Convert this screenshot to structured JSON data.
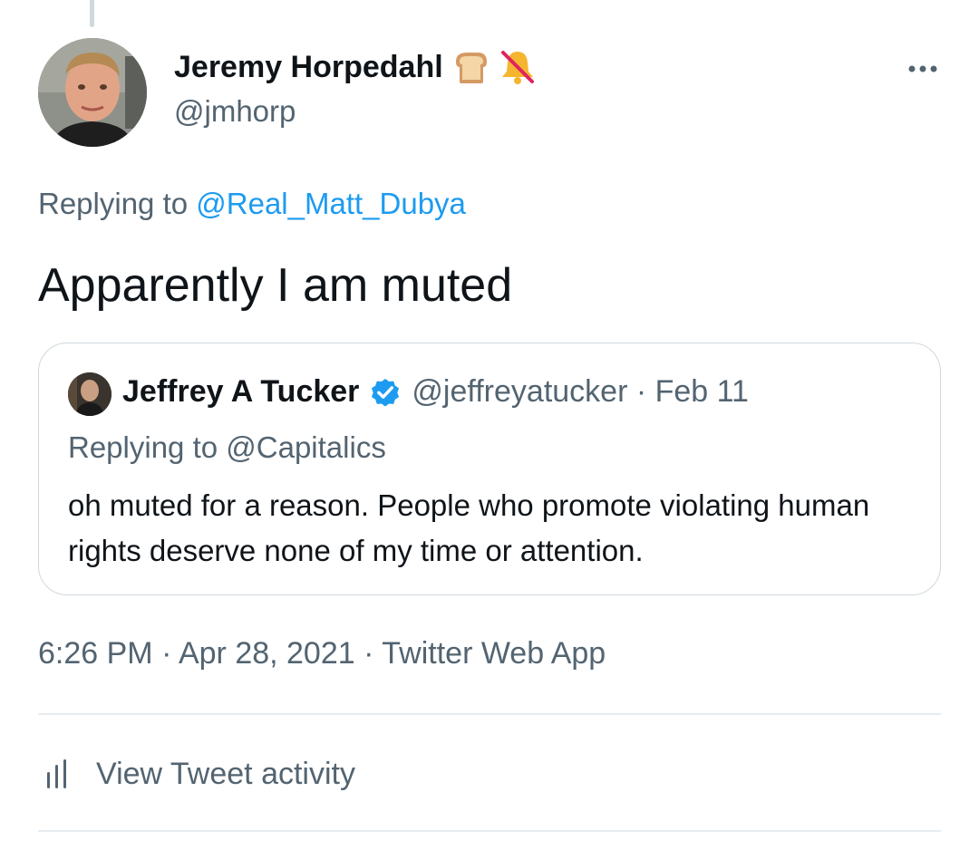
{
  "tweet": {
    "author": {
      "name": "Jeremy Horpedahl",
      "handle": "@jmhorp",
      "name_emojis": [
        "bread-emoji",
        "bell-slash-emoji"
      ]
    },
    "reply_prefix": "Replying to ",
    "reply_to": "@Real_Matt_Dubya",
    "text": "Apparently I am muted",
    "timestamp": "6:26 PM · Apr 28, 2021 · Twitter Web App",
    "activity_label": "View Tweet activity"
  },
  "quoted": {
    "name": "Jeffrey A Tucker",
    "handle_date": "@jeffreyatucker · Feb 11",
    "reply_line": "Replying to @Capitalics",
    "text": "oh muted for a reason. People who promote violating human rights deserve none of my time or attention."
  },
  "colors": {
    "link": "#1d9bf0",
    "secondary_text": "#536471",
    "border": "#cfd9de"
  },
  "icons": [
    "more-icon",
    "verified-badge-icon",
    "activity-chart-icon"
  ]
}
